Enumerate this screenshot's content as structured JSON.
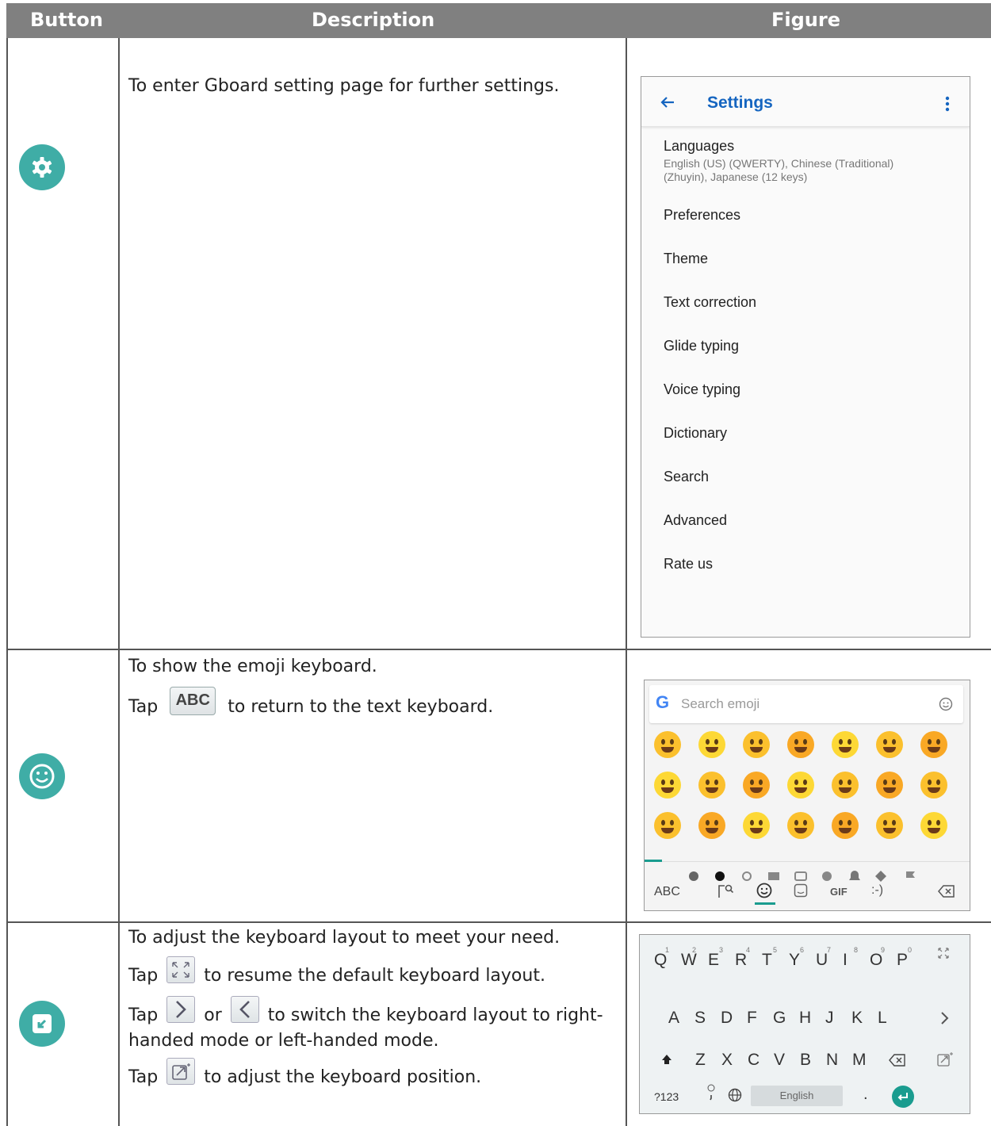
{
  "header": {
    "col1": "Button",
    "col2": "Description",
    "col3": "Figure"
  },
  "row1": {
    "icon": "gear-icon",
    "desc": "To enter Gboard setting page for further settings.",
    "settings": {
      "title": "Settings",
      "lang_title": "Languages",
      "lang_sub": "English (US) (QWERTY), Chinese (Traditional) (Zhuyin), Japanese (12 keys)",
      "items": [
        "Preferences",
        "Theme",
        "Text correction",
        "Glide typing",
        "Voice typing",
        "Dictionary",
        "Search",
        "Advanced",
        "Rate us"
      ]
    }
  },
  "row2": {
    "icon": "emoji-icon",
    "desc1": "To show the emoji keyboard.",
    "desc2_a": "Tap",
    "abc_btn": "ABC",
    "desc2_b": "to return to the text keyboard.",
    "emoji_kb": {
      "search_placeholder": "Search emoji",
      "g_logo": "G",
      "abc": "ABC",
      "gif": "GIF",
      "emoticon": ":-)"
    }
  },
  "row3": {
    "icon": "keyboard-resize-icon",
    "desc1": "To adjust the keyboard layout to meet your need.",
    "desc2_a": "Tap",
    "desc2_b": "to resume the default keyboard layout.",
    "desc3_a": "Tap",
    "desc3_or": "or",
    "desc3_b": "to switch the keyboard layout to right-handed mode or left-handed mode.",
    "desc4_a": "Tap",
    "desc4_b": "to adjust the keyboard position.",
    "kb": {
      "row1": [
        "Q",
        "W",
        "E",
        "R",
        "T",
        "Y",
        "U",
        "I",
        "O",
        "P"
      ],
      "row1_hints": [
        "1",
        "2",
        "3",
        "4",
        "5",
        "6",
        "7",
        "8",
        "9",
        "0"
      ],
      "row2": [
        "A",
        "S",
        "D",
        "F",
        "G",
        "H",
        "J",
        "K",
        "L"
      ],
      "row3": [
        "Z",
        "X",
        "C",
        "V",
        "B",
        "N",
        "M"
      ],
      "sym": "?123",
      "space": "English",
      "period": "."
    }
  },
  "colors": {
    "accent": "#3fada6",
    "header": "#808080",
    "gboard_green": "#1a9c8f",
    "settings_blue": "#1565c0"
  }
}
